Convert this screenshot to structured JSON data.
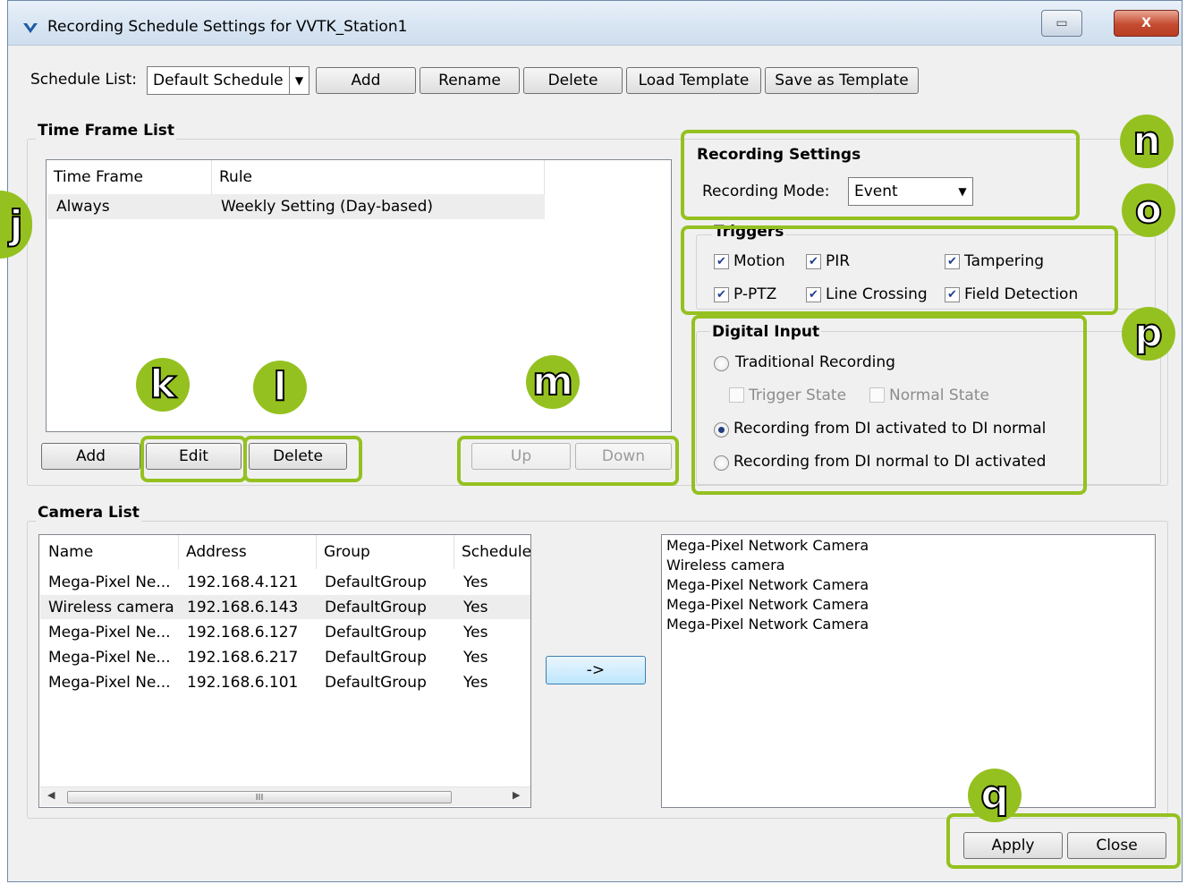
{
  "window": {
    "title": "Recording Schedule Settings for VVTK_Station1",
    "close_glyph": "X",
    "restore_glyph": "▭"
  },
  "schedule": {
    "label": "Schedule List:",
    "selected": "Default Schedule",
    "buttons": {
      "add": "Add",
      "rename": "Rename",
      "delete": "Delete",
      "load_template": "Load Template",
      "save_template": "Save as Template"
    }
  },
  "time_frame": {
    "title": "Time Frame List",
    "columns": [
      "Time Frame",
      "Rule"
    ],
    "rows": [
      {
        "time_frame": "Always",
        "rule": "Weekly Setting (Day-based)"
      }
    ],
    "buttons": {
      "add": "Add",
      "edit": "Edit",
      "delete": "Delete",
      "up": "Up",
      "down": "Down"
    }
  },
  "recording": {
    "title": "Recording Settings",
    "mode_label": "Recording Mode:",
    "mode_value": "Event"
  },
  "triggers": {
    "title": "Triggers",
    "items": [
      {
        "label": "Motion",
        "checked": true
      },
      {
        "label": "PIR",
        "checked": true
      },
      {
        "label": "Tampering",
        "checked": true
      },
      {
        "label": "P-PTZ",
        "checked": true
      },
      {
        "label": "Line Crossing",
        "checked": true
      },
      {
        "label": "Field Detection",
        "checked": true
      }
    ]
  },
  "digital_input": {
    "title": "Digital Input",
    "traditional": "Traditional Recording",
    "trigger_state": "Trigger State",
    "normal_state": "Normal State",
    "option_activated_to_normal": "Recording from DI activated to DI normal",
    "option_normal_to_activated": "Recording from DI normal to DI activated",
    "selected": "option_activated_to_normal"
  },
  "camera_list": {
    "title": "Camera List",
    "columns": [
      "Name",
      "Address",
      "Group",
      "Schedule"
    ],
    "rows": [
      {
        "name": "Mega-Pixel Ne...",
        "address": "192.168.4.121",
        "group": "DefaultGroup",
        "schedule": "Yes"
      },
      {
        "name": "Wireless camera",
        "address": "192.168.6.143",
        "group": "DefaultGroup",
        "schedule": "Yes"
      },
      {
        "name": "Mega-Pixel Ne...",
        "address": "192.168.6.127",
        "group": "DefaultGroup",
        "schedule": "Yes"
      },
      {
        "name": "Mega-Pixel Ne...",
        "address": "192.168.6.217",
        "group": "DefaultGroup",
        "schedule": "Yes"
      },
      {
        "name": "Mega-Pixel Ne...",
        "address": "192.168.6.101",
        "group": "DefaultGroup",
        "schedule": "Yes"
      }
    ],
    "transfer_button": "->",
    "scroll_thumb_grip": "III",
    "assigned": [
      "Mega-Pixel Network Camera",
      "Wireless camera",
      "Mega-Pixel Network Camera",
      "Mega-Pixel Network Camera",
      "Mega-Pixel Network Camera"
    ]
  },
  "footer": {
    "apply": "Apply",
    "close": "Close"
  },
  "annotations": {
    "j": "j",
    "k": "k",
    "l": "l",
    "m": "m",
    "n": "n",
    "o": "o",
    "p": "p",
    "q": "q",
    "color": "#94c11f"
  }
}
